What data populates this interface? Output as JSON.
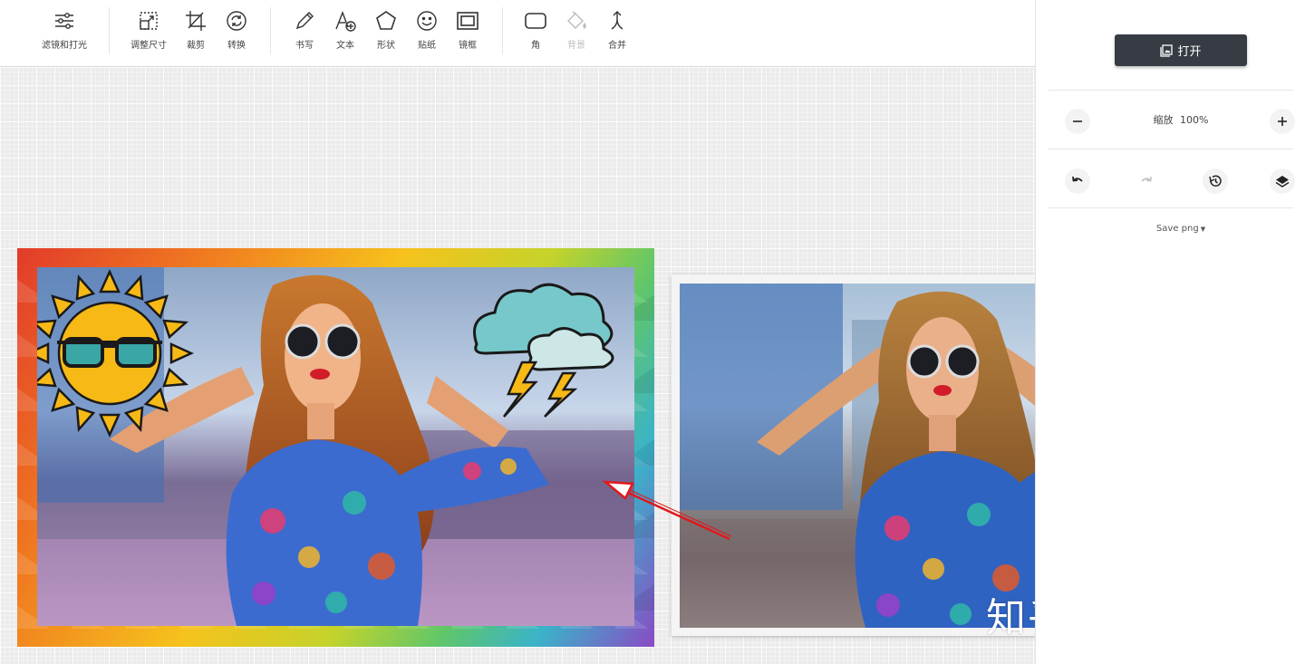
{
  "toolbar": {
    "tools": [
      {
        "label": "滤镜和打光",
        "icon": "sliders-icon"
      },
      {
        "label": "调整尺寸",
        "icon": "resize-icon"
      },
      {
        "label": "裁剪",
        "icon": "crop-icon"
      },
      {
        "label": "转换",
        "icon": "rotate-icon"
      },
      {
        "label": "书写",
        "icon": "pencil-icon"
      },
      {
        "label": "文本",
        "icon": "text-icon"
      },
      {
        "label": "形状",
        "icon": "shape-icon"
      },
      {
        "label": "贴纸",
        "icon": "sticker-icon"
      },
      {
        "label": "镜框",
        "icon": "frame-icon"
      },
      {
        "label": "角",
        "icon": "corner-icon"
      },
      {
        "label": "背景",
        "icon": "paint-bucket-icon",
        "disabled": true
      },
      {
        "label": "合并",
        "icon": "merge-icon"
      }
    ]
  },
  "panel": {
    "open_label": "打开",
    "zoom_label": "缩放",
    "zoom_value": "100%",
    "save_label": "Save png"
  },
  "watermark": "知乎 @拾光探长",
  "colors": {
    "accent_dark": "#373c44",
    "arrow": "#e0191c",
    "sun": "#f7b916",
    "cloud": "#77c8ca"
  }
}
